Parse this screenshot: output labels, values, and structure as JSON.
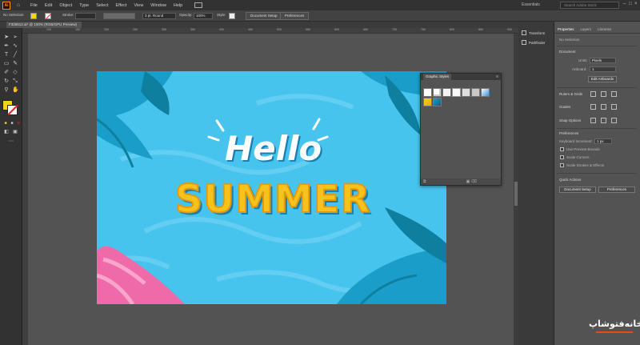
{
  "menubar": {
    "logo": "Ai",
    "items": [
      "File",
      "Edit",
      "Object",
      "Type",
      "Select",
      "Effect",
      "View",
      "Window",
      "Help"
    ],
    "workspace": "Essentials",
    "search_placeholder": "Search Adobe Stock"
  },
  "controlbar": {
    "selection": "No Selection",
    "stroke_label": "Stroke:",
    "brush": "3 pt. Round",
    "opacity_label": "Opacity:",
    "opacity_value": "100%",
    "style_label": "Style:",
    "document_setup": "Document Setup",
    "preferences": "Preferences"
  },
  "document_tab": {
    "title": "F326512.ai* @ 100% (RGB/GPU Preview)"
  },
  "ruler_ticks": [
    "100",
    "150",
    "200",
    "250",
    "300",
    "350",
    "400",
    "450",
    "500",
    "550",
    "600",
    "650",
    "700",
    "750",
    "800",
    "850",
    "900"
  ],
  "artwork": {
    "line1": "Hello",
    "line2": "SUMMER",
    "colors": {
      "water": "#47c4ee",
      "leaf": "#1aa3cf",
      "leaf_dark": "#0f7f9f",
      "text_white": "#ffffff",
      "text_yellow": "#f7c21c",
      "float_pink": "#ef6aa8"
    }
  },
  "graphic_styles_panel": {
    "tab": "Graphic Styles"
  },
  "dock": {
    "items": [
      "Transform",
      "Pathfinder"
    ]
  },
  "properties": {
    "tabs": [
      "Properties",
      "Layers",
      "Libraries"
    ],
    "no_selection": "No Selection",
    "document_header": "Document",
    "units_label": "Units:",
    "units_value": "Pixels",
    "artboard_label": "Artboard:",
    "artboard_value": "1",
    "edit_artboards": "Edit Artboards",
    "rulers_grids": "Rulers & Grids",
    "guides": "Guides",
    "snap_options": "Snap Options",
    "preferences_header": "Preferences",
    "keyboard_increment_label": "Keyboard Increment:",
    "keyboard_increment_value": "1 px",
    "checkboxes": [
      "Use Preview Bounds",
      "Scale Corners",
      "Scale Strokes & Effects"
    ],
    "quick_actions": "Quick Actions",
    "qa_document_setup": "Document Setup",
    "qa_preferences": "Preferences"
  },
  "watermark": {
    "text": "خانه‌فتوشاپ"
  }
}
